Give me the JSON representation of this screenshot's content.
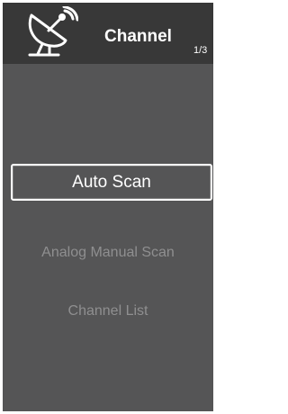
{
  "header": {
    "icon": "satellite-dish-icon",
    "title": "Channel",
    "page_indicator": "1/3"
  },
  "menu": {
    "items": [
      {
        "label": "Auto Scan",
        "selected": true
      },
      {
        "label": "Analog Manual Scan",
        "selected": false
      },
      {
        "label": "Channel List",
        "selected": false
      }
    ]
  },
  "colors": {
    "background": "#555556",
    "header_background": "#383838",
    "active_text": "#ffffff",
    "inactive_text": "#8f8f90"
  }
}
